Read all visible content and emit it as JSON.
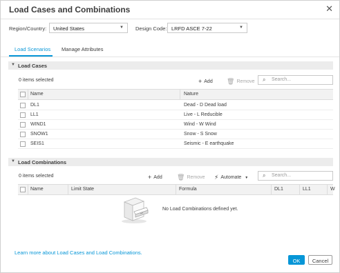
{
  "dialog": {
    "title": "Load Cases and Combinations"
  },
  "filters": {
    "region_label": "Region/Country:",
    "region_value": "United States",
    "design_code_label": "Design Code:",
    "design_code_value": "LRFD ASCE 7-22"
  },
  "tabs": [
    {
      "label": "Load Scenarios",
      "active": true
    },
    {
      "label": "Manage Attributes",
      "active": false
    }
  ],
  "load_cases": {
    "title": "Load Cases",
    "selected_count": "0 items selected",
    "add_label": "Add",
    "remove_label": "Remove",
    "search_placeholder": "Search...",
    "columns": [
      "Name",
      "Nature"
    ],
    "rows": [
      {
        "name": "DL1",
        "nature": "Dead - D Dead load"
      },
      {
        "name": "LL1",
        "nature": "Live - L Reducible"
      },
      {
        "name": "WIND1",
        "nature": "Wind - W Wind"
      },
      {
        "name": "SNOW1",
        "nature": "Snow - S Snow"
      },
      {
        "name": "SEIS1",
        "nature": "Seismic - E earthquake"
      }
    ]
  },
  "load_combinations": {
    "title": "Load Combinations",
    "selected_count": "0 items selected",
    "add_label": "Add",
    "remove_label": "Remove",
    "automate_label": "Automate",
    "search_placeholder": "Search...",
    "columns": [
      "Name",
      "Limit State",
      "Formula",
      "DL1",
      "LL1",
      "W"
    ],
    "empty_message": "No Load Combinations defined yet."
  },
  "footer": {
    "link_text": "Learn more about Load Cases and Load Combinations.",
    "ok_label": "OK",
    "cancel_label": "Cancel"
  },
  "colors": {
    "accent": "#0696d7",
    "header_bg": "#ececec"
  },
  "icons": [
    "close-icon",
    "chevron-down-icon",
    "plus-icon",
    "trash-icon",
    "lightning-icon",
    "search-icon",
    "empty-cabinet-icon"
  ]
}
